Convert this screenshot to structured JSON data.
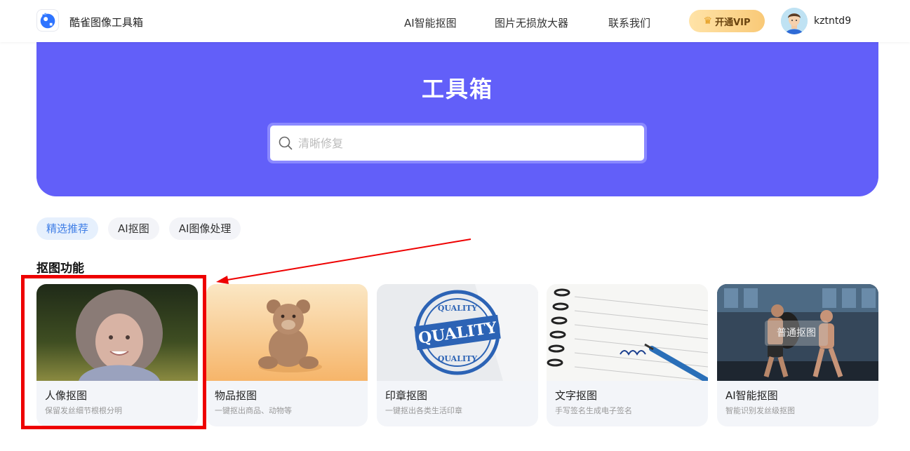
{
  "nav": {
    "brand": "酷雀图像工具箱",
    "links": [
      "AI智能抠图",
      "图片无损放大器",
      "联系我们"
    ],
    "vip_label": "开通VIP",
    "username": "kztntd9"
  },
  "hero": {
    "title": "工具箱",
    "search_placeholder": "清晰修复"
  },
  "tabs": [
    "精选推荐",
    "AI抠图",
    "AI图像处理"
  ],
  "active_tab": 0,
  "section_title": "抠图功能",
  "cards": [
    {
      "title": "人像抠图",
      "desc": "保留发丝细节根根分明"
    },
    {
      "title": "物品抠图",
      "desc": "一键抠出商品、动物等"
    },
    {
      "title": "印章抠图",
      "desc": "一键抠出各类生活印章"
    },
    {
      "title": "文字抠图",
      "desc": "手写签名生成电子签名"
    },
    {
      "title": "AI智能抠图",
      "desc": "智能识别发丝级抠图",
      "overlay": "普通抠图"
    }
  ],
  "stamp_text": {
    "top": "QUALITY",
    "center": "QUALITY",
    "bottom": "QUALITY"
  },
  "colors": {
    "hero_bg": "#625ff9",
    "annotation": "#ee0000",
    "tab_active": "#3f7ee6"
  }
}
